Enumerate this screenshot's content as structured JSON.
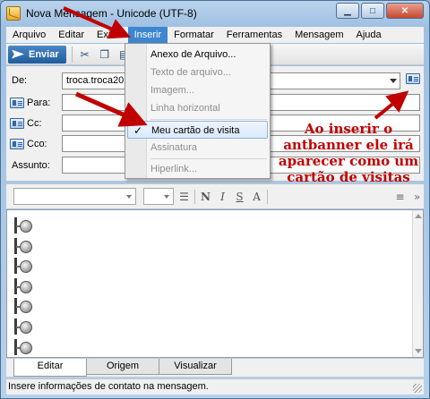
{
  "window": {
    "title": "Nova Mensagem - Unicode (UTF-8)",
    "controls": [
      "minimize",
      "maximize",
      "close"
    ]
  },
  "menubar": {
    "items": [
      "Arquivo",
      "Editar",
      "Exibir",
      "Inserir",
      "Formatar",
      "Ferramentas",
      "Mensagem",
      "Ajuda"
    ],
    "active": "Inserir"
  },
  "toolbar": {
    "send_label": "Enviar",
    "icons": [
      "cut-icon",
      "copy-icon",
      "paste-icon"
    ]
  },
  "header": {
    "from_label": "De:",
    "from_value": "troca.troca2014",
    "to_label": "Para:",
    "cc_label": "Cc:",
    "bcc_label": "Cco:",
    "subject_label": "Assunto:"
  },
  "insert_menu": {
    "items": [
      {
        "label": "Anexo de Arquivo...",
        "enabled": true
      },
      {
        "label": "Texto de arquivo...",
        "enabled": false
      },
      {
        "label": "Imagem...",
        "enabled": false
      },
      {
        "label": "Linha horizontal",
        "enabled": false
      },
      {
        "label": "Meu cartão de visita",
        "enabled": true,
        "checked": true,
        "highlighted": true
      },
      {
        "label": "Assinatura",
        "enabled": false
      },
      {
        "label": "Hiperlink...",
        "enabled": false
      }
    ]
  },
  "format_bar": {
    "font": "",
    "size": "",
    "buttons": [
      "N",
      "I",
      "S",
      "A"
    ]
  },
  "annotation": {
    "text": "Ao inserir o antbanner ele irá aparecer como um cartão de visitas",
    "color": "#c00000"
  },
  "tabs": {
    "items": [
      "Editar",
      "Origem",
      "Visualizar"
    ],
    "active": "Editar"
  },
  "status": {
    "text": "Insere informações de contato na mensagem."
  },
  "colors": {
    "menu_active": "#3d86d0",
    "send_button": "#2a6aad",
    "arrow": "#c00000"
  }
}
